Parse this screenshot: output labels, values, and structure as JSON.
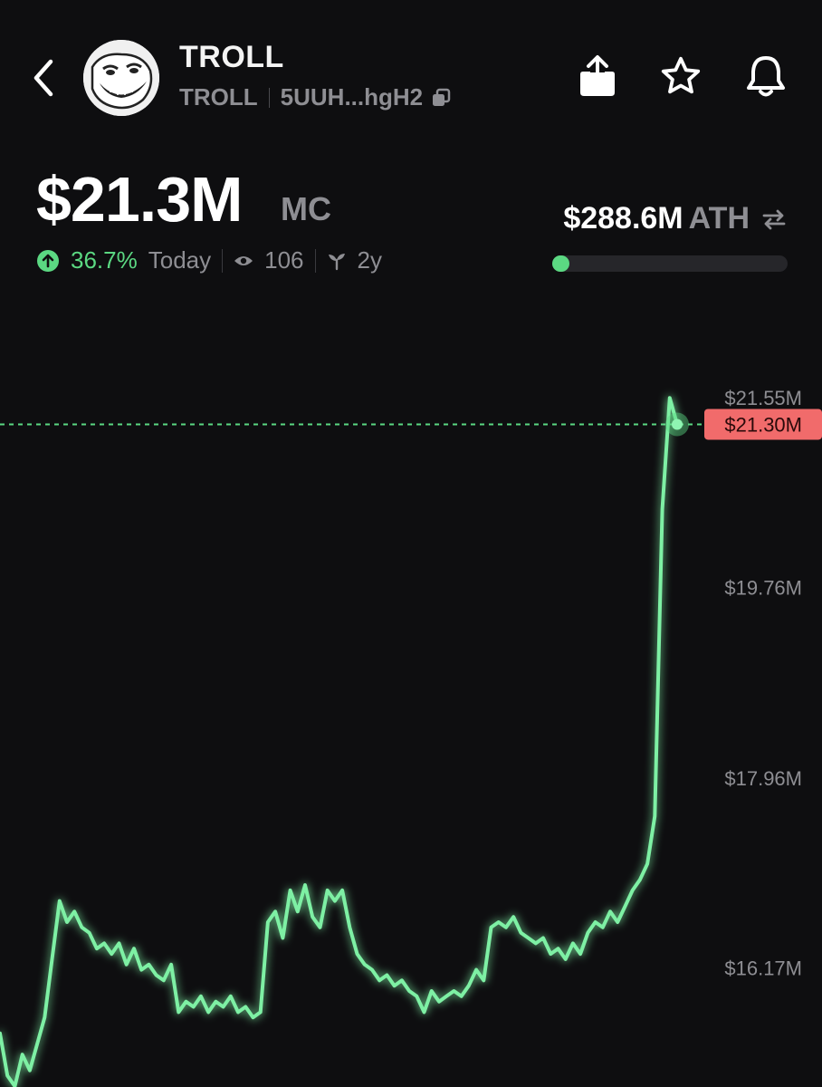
{
  "header": {
    "token_name": "TROLL",
    "ticker": "TROLL",
    "address": "5UUH...hgH2",
    "icons": [
      "back-chevron-icon",
      "share-icon",
      "star-icon",
      "bell-icon",
      "copy-icon"
    ]
  },
  "market": {
    "market_cap": "$21.3M",
    "market_cap_label": "MC",
    "change_pct": "36.7%",
    "change_period": "Today",
    "views": "106",
    "age": "2y",
    "ath_value": "$288.6M",
    "ath_label": "ATH",
    "ath_progress_fraction": 0.074
  },
  "colors": {
    "background": "#0e0e10",
    "accent_green": "#5bd882",
    "price_tag_red": "#f16b6b",
    "muted_text": "#8e8e93"
  },
  "chart_data": {
    "type": "line",
    "y_tick_labels": [
      "$21.55M",
      "$19.76M",
      "$17.96M",
      "$16.17M"
    ],
    "y_ticks": [
      21.55,
      19.76,
      17.96,
      16.17
    ],
    "current_price_label": "$21.30M",
    "current_value": 21.3,
    "ylim": [
      15.3,
      21.8
    ],
    "grid": false,
    "values": [
      15.55,
      15.15,
      15.05,
      15.35,
      15.2,
      15.45,
      15.7,
      16.25,
      16.8,
      16.6,
      16.7,
      16.55,
      16.5,
      16.35,
      16.4,
      16.3,
      16.4,
      16.2,
      16.35,
      16.15,
      16.2,
      16.1,
      16.05,
      16.2,
      15.75,
      15.85,
      15.8,
      15.9,
      15.75,
      15.85,
      15.8,
      15.9,
      15.75,
      15.8,
      15.7,
      15.75,
      16.6,
      16.7,
      16.45,
      16.9,
      16.7,
      16.95,
      16.65,
      16.55,
      16.9,
      16.8,
      16.9,
      16.55,
      16.3,
      16.2,
      16.15,
      16.05,
      16.1,
      16.0,
      16.05,
      15.95,
      15.9,
      15.75,
      15.95,
      15.85,
      15.9,
      15.95,
      15.9,
      16.0,
      16.15,
      16.05,
      16.55,
      16.6,
      16.55,
      16.65,
      16.5,
      16.45,
      16.4,
      16.45,
      16.3,
      16.35,
      16.25,
      16.4,
      16.3,
      16.5,
      16.6,
      16.55,
      16.7,
      16.6,
      16.75,
      16.9,
      17.0,
      17.15,
      17.6,
      20.5,
      21.55,
      21.3
    ]
  }
}
